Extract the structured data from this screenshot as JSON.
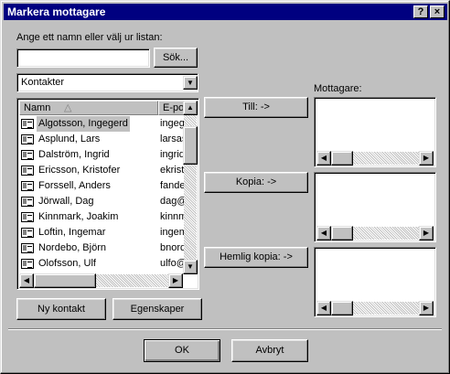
{
  "window": {
    "title": "Markera mottagare",
    "help_glyph": "?",
    "close_glyph": "×"
  },
  "search": {
    "prompt": "Ange ett namn eller välj ur listan:",
    "value": "",
    "button": "Sök..."
  },
  "source": {
    "selected": "Kontakter"
  },
  "list": {
    "columns": [
      "Namn",
      "E-post"
    ],
    "rows": [
      {
        "name": "Algotsson, Ingegerd",
        "email": "ingegerd"
      },
      {
        "name": "Asplund, Lars",
        "email": "larsasp"
      },
      {
        "name": "Dalström, Ingrid",
        "email": "ingrid"
      },
      {
        "name": "Ericsson, Kristofer",
        "email": "ekristo"
      },
      {
        "name": "Forssell, Anders",
        "email": "fanders"
      },
      {
        "name": "Jörwall, Dag",
        "email": "dag@"
      },
      {
        "name": "Kinnmark, Joakim",
        "email": "kinnm"
      },
      {
        "name": "Loftin, Ingemar",
        "email": "ingem"
      },
      {
        "name": "Nordebo, Björn",
        "email": "bnorde"
      },
      {
        "name": "Olofsson, Ulf",
        "email": "ulfo@"
      }
    ]
  },
  "buttons": {
    "to": "Till: ->",
    "cc": "Kopia: ->",
    "bcc": "Hemlig kopia: ->",
    "new_contact": "Ny kontakt",
    "properties": "Egenskaper",
    "ok": "OK",
    "cancel": "Avbryt"
  },
  "recipients": {
    "label": "Mottagare:"
  },
  "icons": {
    "contact": "contact-card-icon",
    "sort": "sort-ascending-icon",
    "dropdown": "chevron-down-icon"
  }
}
